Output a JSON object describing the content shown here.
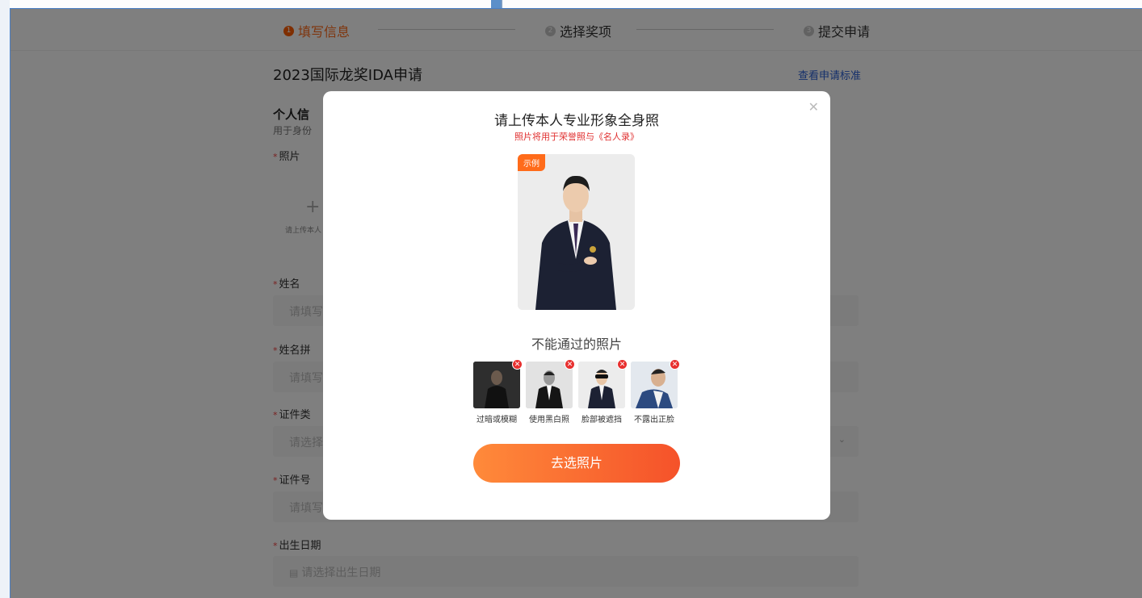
{
  "steps": [
    {
      "num": "1",
      "label": "填写信息"
    },
    {
      "num": "2",
      "label": "选择奖项"
    },
    {
      "num": "3",
      "label": "提交申请"
    }
  ],
  "page": {
    "title": "2023国际龙奖IDA申请",
    "criteria_link": "查看申请标准"
  },
  "section": {
    "title": "个人信",
    "subtitle": "用于身份"
  },
  "form": {
    "photo_label": "照片",
    "photo_hint": "请上传本人",
    "name_label": "姓名",
    "name_placeholder": "请填写",
    "pinyin_label": "姓名拼",
    "pinyin_placeholder": "请填写",
    "idtype_label": "证件类",
    "idtype_placeholder": "请选择",
    "idno_label": "证件号",
    "idno_placeholder": "请填写",
    "birth_label": "出生日期",
    "birth_placeholder": "请选择出生日期"
  },
  "modal": {
    "title": "请上传本人专业形象全身照",
    "note": "照片将用于荣誉照与《名人录》",
    "example_badge": "示例",
    "bad_title": "不能通过的照片",
    "bad_examples": [
      {
        "caption": "过暗或模糊"
      },
      {
        "caption": "使用黑白照"
      },
      {
        "caption": "脸部被遮挡"
      },
      {
        "caption": "不露出正脸"
      }
    ],
    "button": "去选照片"
  },
  "colors": {
    "accent": "#ff6b1a",
    "link": "#2a60d6",
    "error": "#e8302f"
  }
}
